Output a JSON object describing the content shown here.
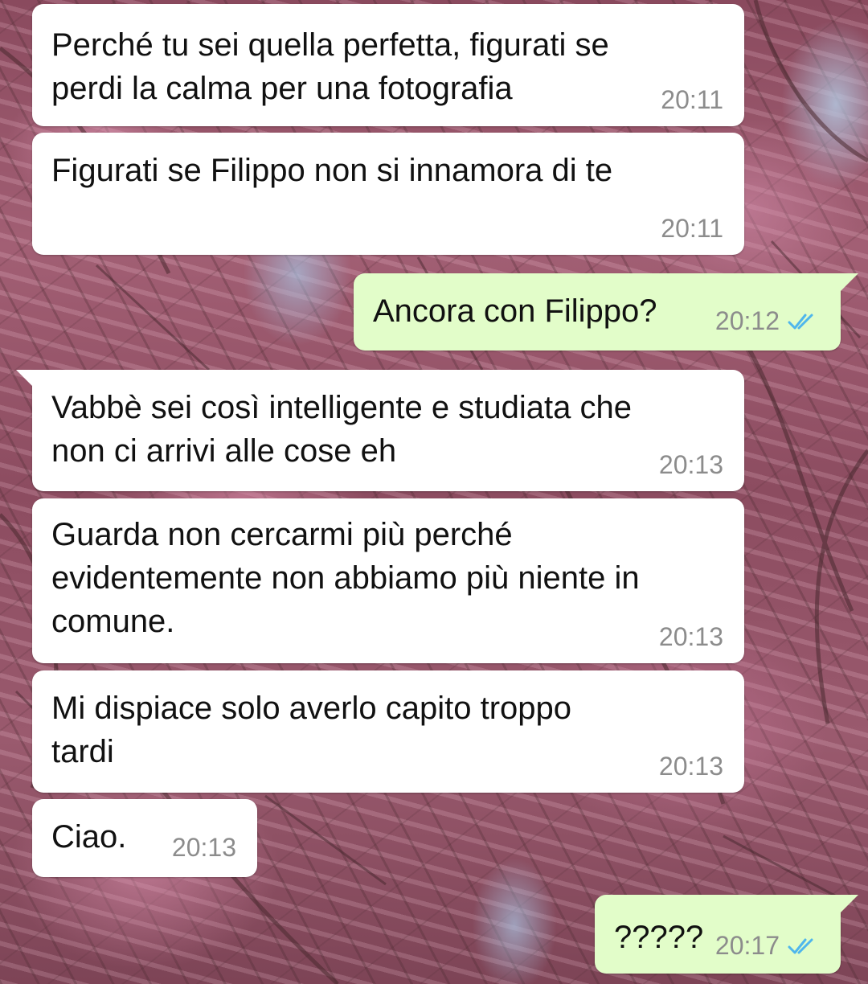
{
  "conversation": {
    "messages": [
      {
        "direction": "incoming",
        "text": "Perché tu sei quella perfetta, figurati se\nperdi la calma per una fotografia",
        "time": "20:11"
      },
      {
        "direction": "incoming",
        "text": "Figurati se Filippo non si innamora di te",
        "time": "20:11"
      },
      {
        "direction": "outgoing",
        "text": "Ancora con Filippo?",
        "time": "20:12",
        "status_icon": "double-check-read-icon"
      },
      {
        "direction": "incoming",
        "text": "Vabbè sei così intelligente e studiata che\nnon ci arrivi alle cose eh",
        "time": "20:13"
      },
      {
        "direction": "incoming",
        "text": "Guarda non cercarmi più perché\nevidentemente non abbiamo più niente in\ncomune.",
        "time": "20:13"
      },
      {
        "direction": "incoming",
        "text": "Mi dispiace solo averlo capito troppo\ntardi",
        "time": "20:13"
      },
      {
        "direction": "incoming",
        "text": "Ciao.",
        "time": "20:13"
      },
      {
        "direction": "outgoing",
        "text": "?????",
        "time": "20:17",
        "status_icon": "double-check-read-icon"
      }
    ]
  },
  "colors": {
    "incoming_bubble": "#ffffff",
    "outgoing_bubble": "#e2fdc9",
    "timestamp": "#8c8c8c",
    "read_tick": "#4fb6ec",
    "wallpaper": "#8a4a5e"
  }
}
